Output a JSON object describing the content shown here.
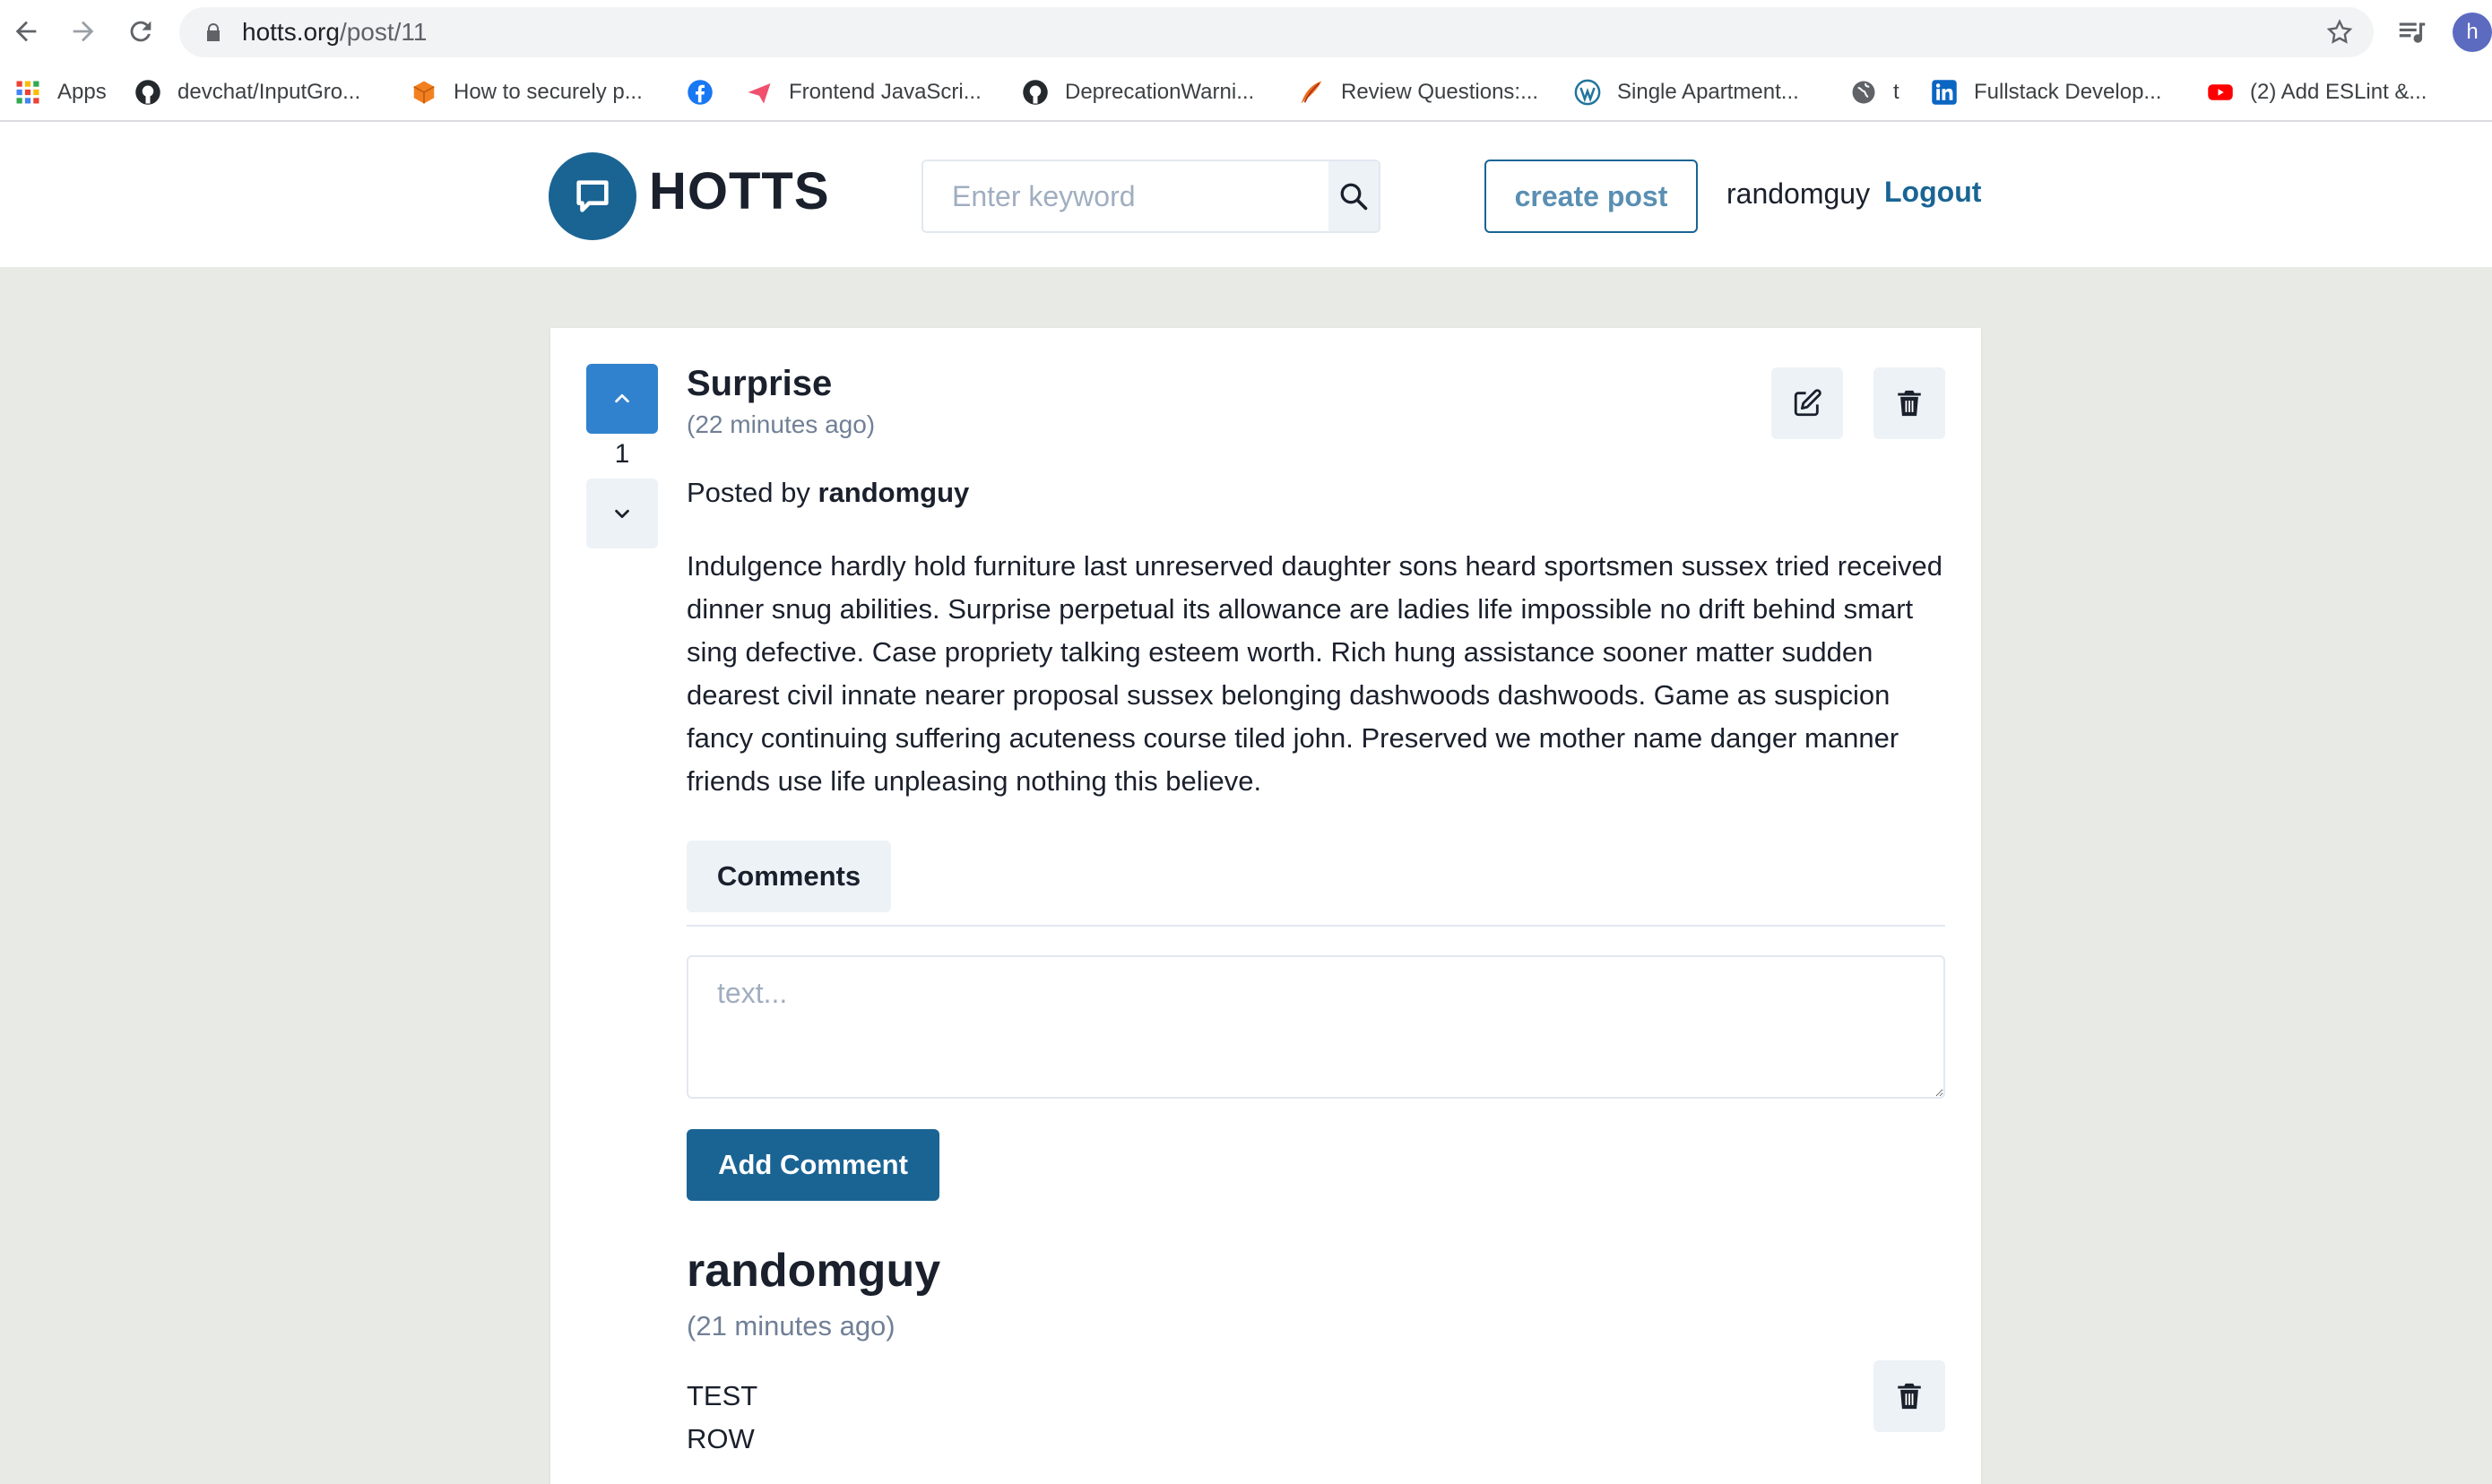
{
  "browser": {
    "url_host": "hotts.org",
    "url_path": "/post/11",
    "profile_initial": "h",
    "bookmarks": [
      {
        "label": "Apps",
        "icon": "apps-grid-icon"
      },
      {
        "label": "devchat/InputGro...",
        "icon": "github-icon"
      },
      {
        "label": "How to securely p...",
        "icon": "cube-icon"
      },
      {
        "label": "",
        "icon": "facebook-icon"
      },
      {
        "label": "Frontend JavaScri...",
        "icon": "paper-plane-icon"
      },
      {
        "label": "DeprecationWarni...",
        "icon": "github-icon"
      },
      {
        "label": "Review Questions:...",
        "icon": "quill-icon"
      },
      {
        "label": "Single Apartment...",
        "icon": "wordpress-icon"
      },
      {
        "label": "t",
        "icon": "globe-icon"
      },
      {
        "label": "Fullstack Develop...",
        "icon": "linkedin-icon"
      },
      {
        "label": "(2) Add ESLint &...",
        "icon": "youtube-icon"
      }
    ]
  },
  "header": {
    "logo_text": "HOTTS",
    "search_placeholder": "Enter keyword",
    "create_post_label": "create post",
    "username": "randomguy",
    "logout_label": "Logout"
  },
  "post": {
    "vote_count": "1",
    "title": "Surprise",
    "time": "(22 minutes ago)",
    "posted_by_prefix": "Posted by",
    "author": "randomguy",
    "body": "Indulgence hardly hold furniture last unreserved daughter sons heard sportsmen sussex tried received dinner snug abilities. Surprise perpetual its allowance are ladies life impossible no drift behind smart sing defective. Case propriety talking esteem worth. Rich hung assistance sooner matter sudden dearest civil innate nearer proposal sussex belonging dashwoods dashwoods. Game as suspicion fancy continuing suffering acuteness course tiled john. Preserved we mother name danger manner friends use life unpleasing nothing this believe."
  },
  "comments_section": {
    "tab_label": "Comments",
    "textarea_placeholder": "text...",
    "add_button_label": "Add Comment",
    "items": [
      {
        "author": "randomguy",
        "time": "(21 minutes ago)",
        "lines": [
          "TEST",
          "ROW"
        ]
      }
    ]
  },
  "colors": {
    "brand": "#1a6494",
    "vote_active": "#3182ce",
    "page_bg": "#e8eae5"
  }
}
